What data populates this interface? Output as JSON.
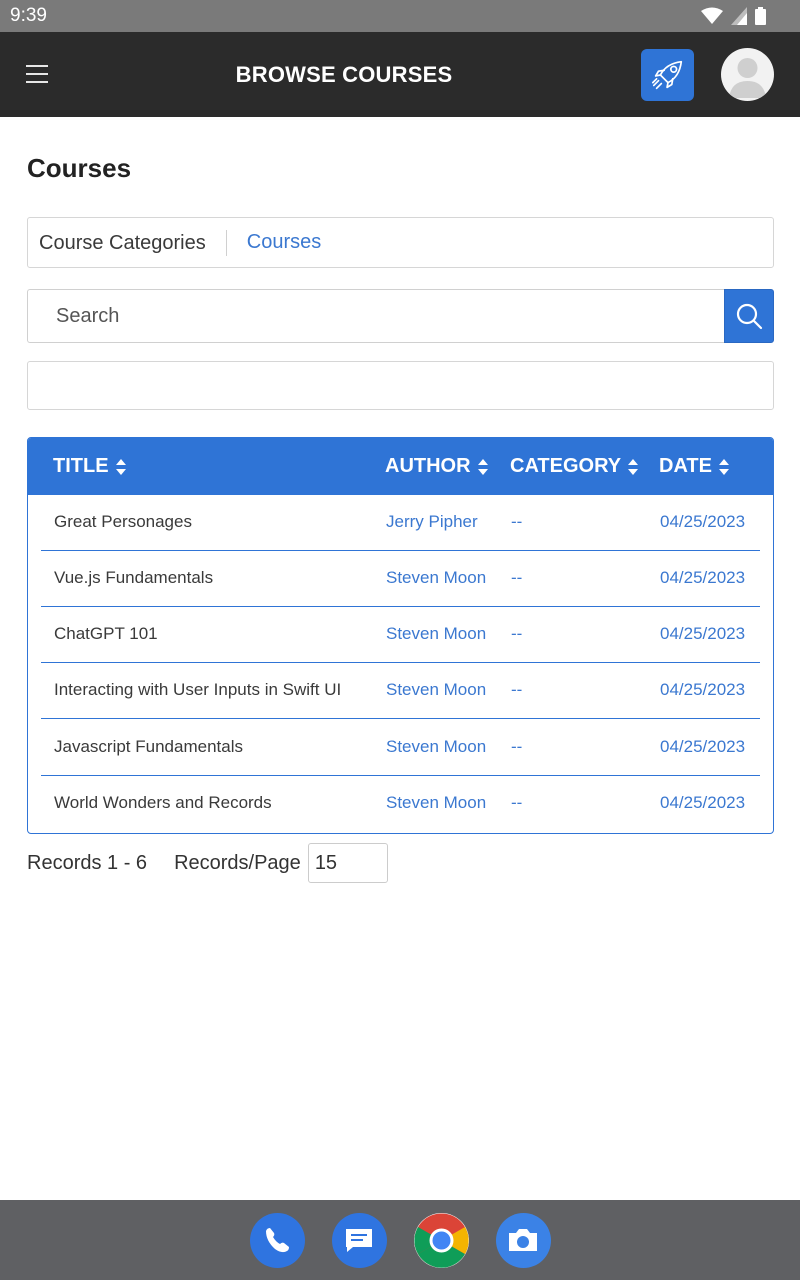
{
  "status": {
    "time": "9:39"
  },
  "header": {
    "title": "BROWSE COURSES"
  },
  "page": {
    "title": "Courses"
  },
  "tabs": [
    {
      "label": "Course Categories"
    },
    {
      "label": "Courses"
    }
  ],
  "search": {
    "placeholder": "Search"
  },
  "table": {
    "columns": [
      "TITLE",
      "AUTHOR",
      "CATEGORY",
      "DATE"
    ],
    "rows": [
      {
        "title": "Great Personages",
        "author": "Jerry Pipher",
        "category": "--",
        "date": "04/25/2023"
      },
      {
        "title": "Vue.js Fundamentals",
        "author": "Steven Moon",
        "category": "--",
        "date": "04/25/2023"
      },
      {
        "title": "ChatGPT 101",
        "author": "Steven Moon",
        "category": "--",
        "date": "04/25/2023"
      },
      {
        "title": "Interacting with User Inputs in Swift UI",
        "author": "Steven Moon",
        "category": "--",
        "date": "04/25/2023"
      },
      {
        "title": "Javascript Fundamentals",
        "author": "Steven Moon",
        "category": "--",
        "date": "04/25/2023"
      },
      {
        "title": "World Wonders and Records",
        "author": "Steven Moon",
        "category": "--",
        "date": "04/25/2023"
      }
    ]
  },
  "pagination": {
    "records_label": "Records 1 - 6",
    "per_page_label": "Records/Page",
    "per_page_value": "15"
  },
  "colors": {
    "accent": "#2f74d6",
    "header_bg": "#2b2b2b",
    "status_bg": "#7a7a7a",
    "nav_bg": "#5f6063"
  },
  "dock": [
    "phone-icon",
    "messages-icon",
    "chrome-icon",
    "camera-icon"
  ]
}
